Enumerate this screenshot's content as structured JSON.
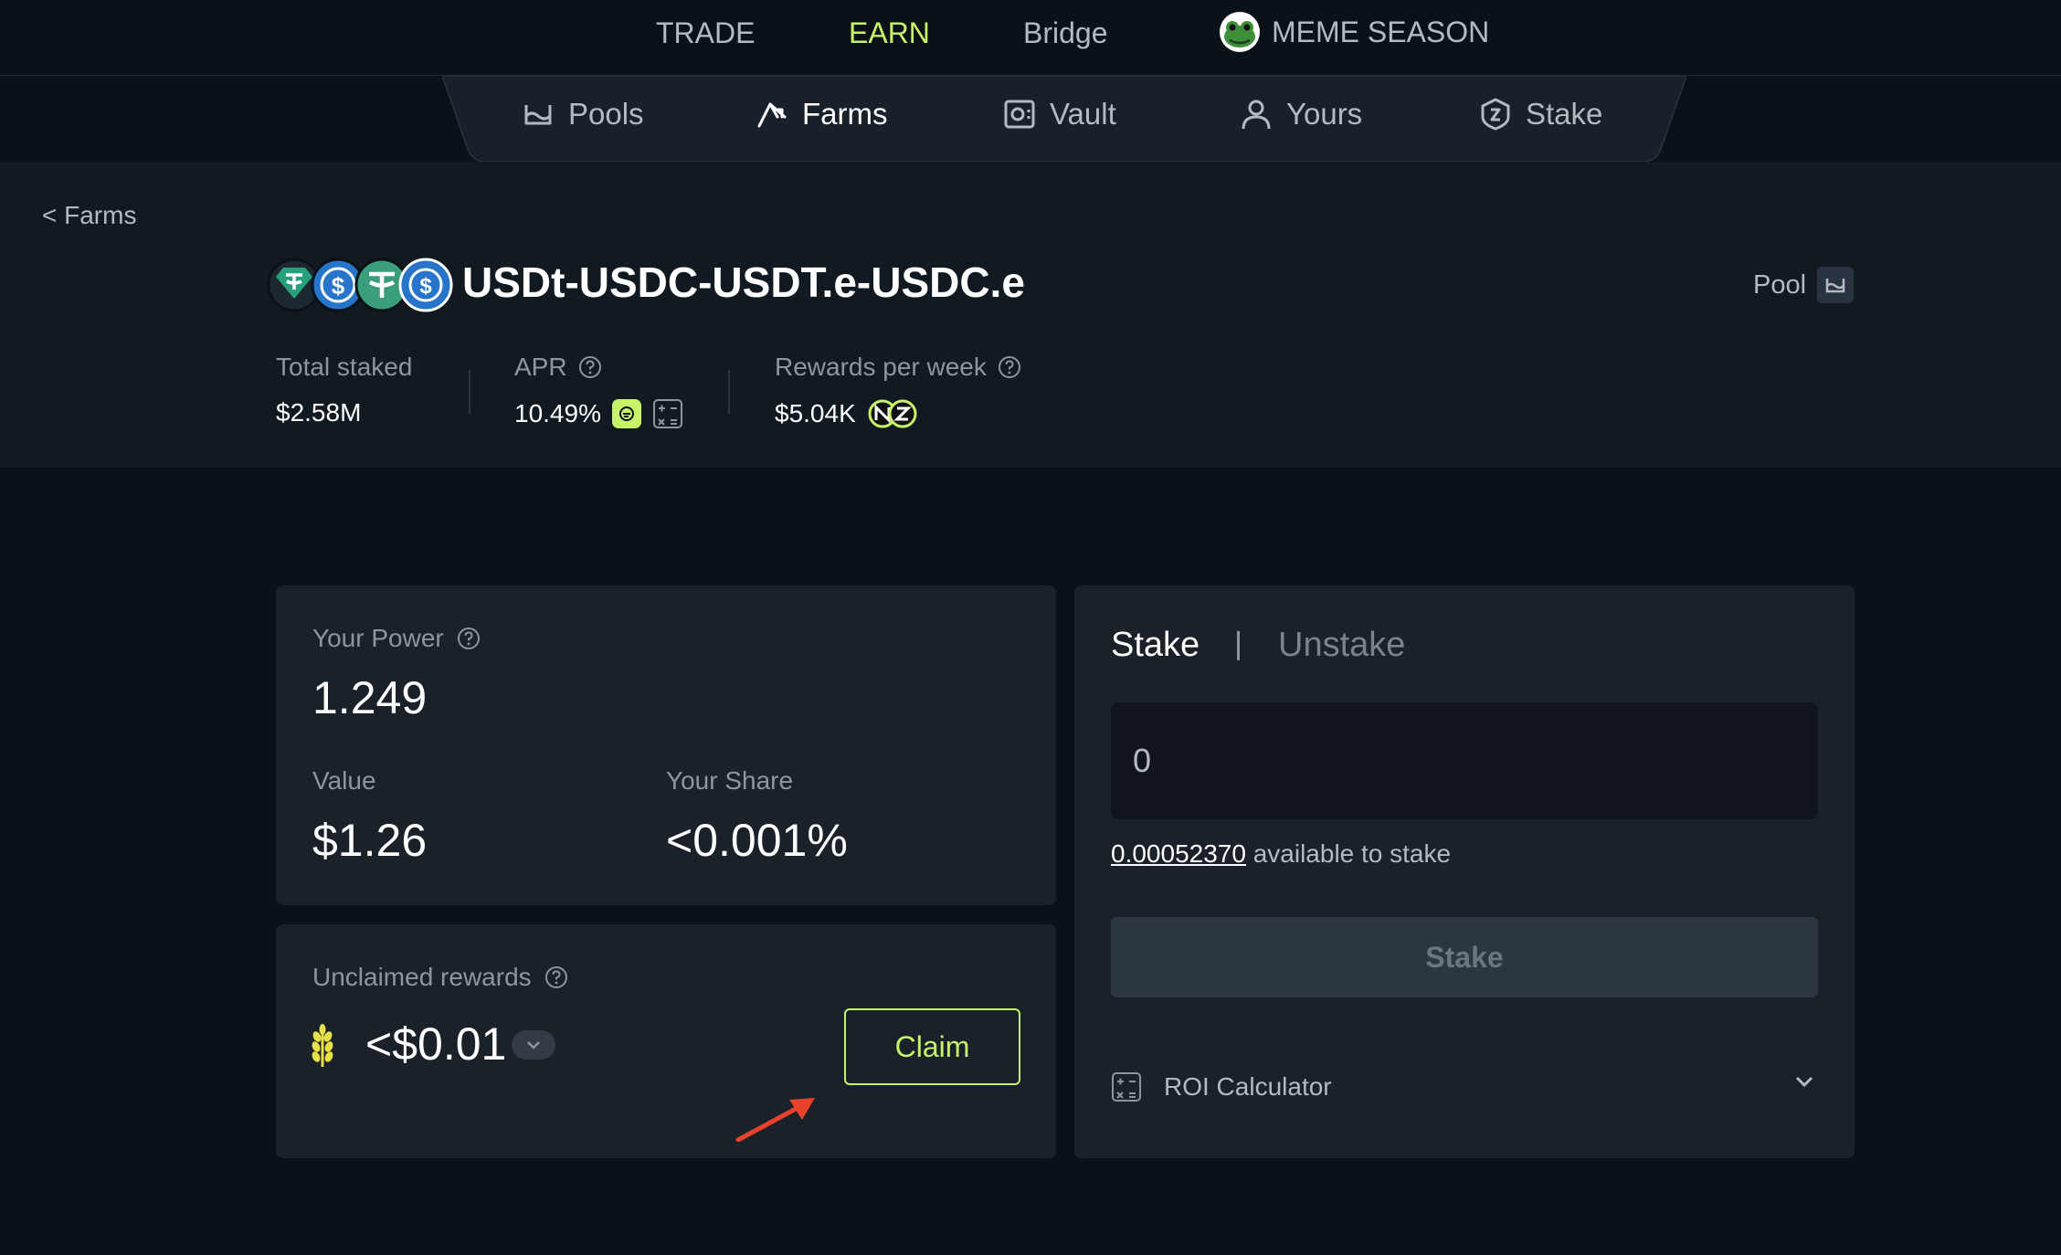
{
  "top_nav": {
    "items": [
      {
        "label": "TRADE"
      },
      {
        "label": "EARN"
      },
      {
        "label": "Bridge"
      },
      {
        "label": "MEME SEASON"
      }
    ],
    "active_color": "#c7f36a"
  },
  "sub_nav": {
    "items": [
      {
        "label": "Pools",
        "icon": "pools-icon"
      },
      {
        "label": "Farms",
        "icon": "farms-icon"
      },
      {
        "label": "Vault",
        "icon": "vault-icon"
      },
      {
        "label": "Yours",
        "icon": "user-icon"
      },
      {
        "label": "Stake",
        "icon": "stake-shield-icon"
      }
    ],
    "active": "Farms"
  },
  "breadcrumb": {
    "back_label": "< Farms"
  },
  "pair": {
    "title": "USDt-USDC-USDT.e-USDC.e",
    "tokens": [
      "USDt",
      "USDC",
      "USDT.e",
      "USDC.e"
    ]
  },
  "pool_link": {
    "label": "Pool"
  },
  "stats": {
    "total_staked": {
      "label": "Total staked",
      "value": "$2.58M"
    },
    "apr": {
      "label": "APR",
      "value": "10.49%"
    },
    "rewards_per_week": {
      "label": "Rewards per week",
      "value": "$5.04K"
    }
  },
  "power_card": {
    "your_power_label": "Your Power",
    "your_power_value": "1.249",
    "value_label": "Value",
    "value_value": "$1.26",
    "share_label": "Your Share",
    "share_value": "<0.001%"
  },
  "rewards_card": {
    "label": "Unclaimed rewards",
    "value": "<$0.01",
    "claim_label": "Claim"
  },
  "stake_card": {
    "tabs": [
      {
        "label": "Stake"
      },
      {
        "label": "Unstake"
      }
    ],
    "active_tab": "Stake",
    "input_value": "0",
    "available_amount": "0.00052370",
    "available_suffix": " available to stake",
    "stake_button_label": "Stake",
    "roi_label": "ROI Calculator"
  },
  "colors": {
    "background": "#0a1117",
    "hero": "#121a21",
    "card": "#1b2128",
    "accent": "#c7f36a",
    "arrow": "#e8412c"
  }
}
